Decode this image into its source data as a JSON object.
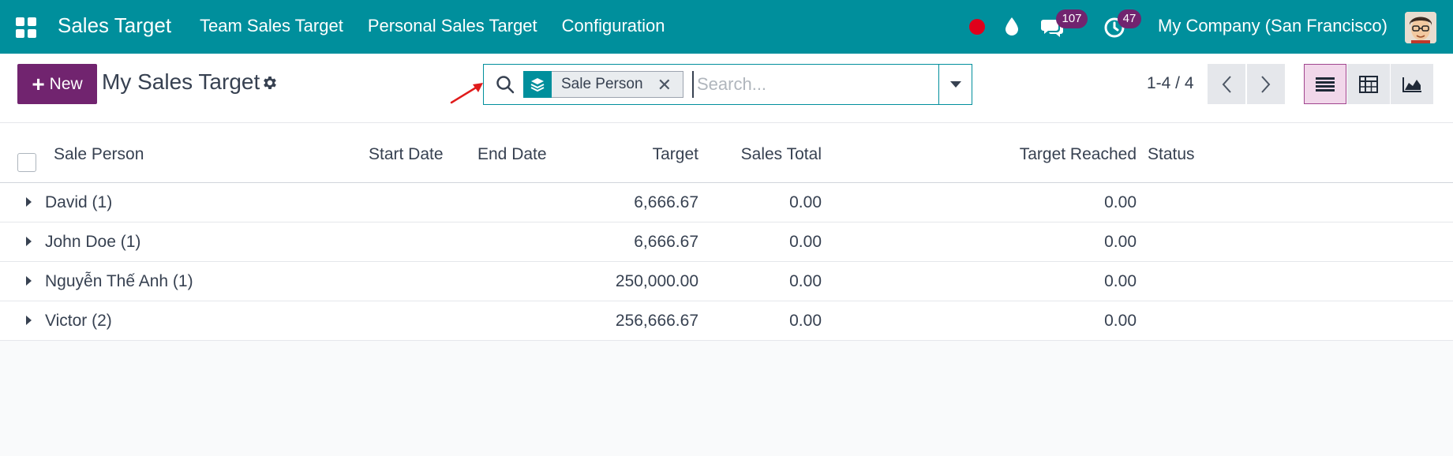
{
  "navbar": {
    "app_title": "Sales Target",
    "menu": [
      {
        "label": "Team Sales Target"
      },
      {
        "label": "Personal Sales Target"
      },
      {
        "label": "Configuration"
      }
    ],
    "chat_badge": "107",
    "activity_badge": "47",
    "company": "My Company (San Francisco)"
  },
  "control_panel": {
    "new_label": "New",
    "page_title": "My Sales Target",
    "search": {
      "facet_label": "Sale Person",
      "placeholder": "Search..."
    },
    "pager": "1-4 / 4"
  },
  "table": {
    "columns": {
      "sale_person": "Sale Person",
      "start_date": "Start Date",
      "end_date": "End Date",
      "target": "Target",
      "sales_total": "Sales Total",
      "target_reached": "Target Reached",
      "status": "Status"
    },
    "rows": [
      {
        "group": "David (1)",
        "target": "6,666.67",
        "sales_total": "0.00",
        "target_reached": "0.00"
      },
      {
        "group": "John Doe (1)",
        "target": "6,666.67",
        "sales_total": "0.00",
        "target_reached": "0.00"
      },
      {
        "group": "Nguyễn Thế Anh (1)",
        "target": "250,000.00",
        "sales_total": "0.00",
        "target_reached": "0.00"
      },
      {
        "group": "Victor (2)",
        "target": "256,666.67",
        "sales_total": "0.00",
        "target_reached": "0.00"
      }
    ]
  },
  "colors": {
    "navbar": "#008f9c",
    "primary": "#71246f",
    "record_dot": "#e0001b",
    "annotation_arrow": "#e01b1b"
  }
}
